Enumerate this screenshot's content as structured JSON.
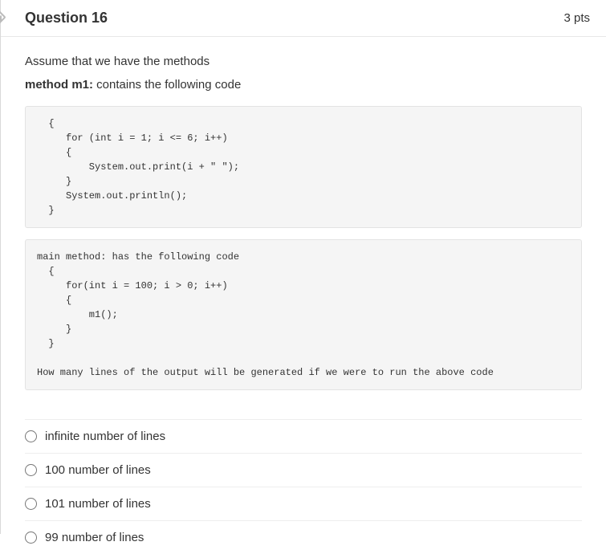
{
  "header": {
    "title": "Question 16",
    "points": "3 pts"
  },
  "prompt": {
    "line1": "Assume that we have the methods",
    "line2_bold": "method m1:",
    "line2_rest": "  contains the following code"
  },
  "code_block_1": "  {\n     for (int i = 1; i <= 6; i++)\n     {\n         System.out.print(i + \" \");\n     }\n     System.out.println();\n  }",
  "code_block_2": "main method: has the following code\n  {\n     for(int i = 100; i > 0; i++)\n     {\n         m1();\n     }\n  }\n\nHow many lines of the output will be generated if we were to run the above code",
  "options": [
    {
      "label": "infinite number of lines"
    },
    {
      "label": "100 number of lines"
    },
    {
      "label": "101 number of lines"
    },
    {
      "label": "99 number of lines"
    }
  ]
}
